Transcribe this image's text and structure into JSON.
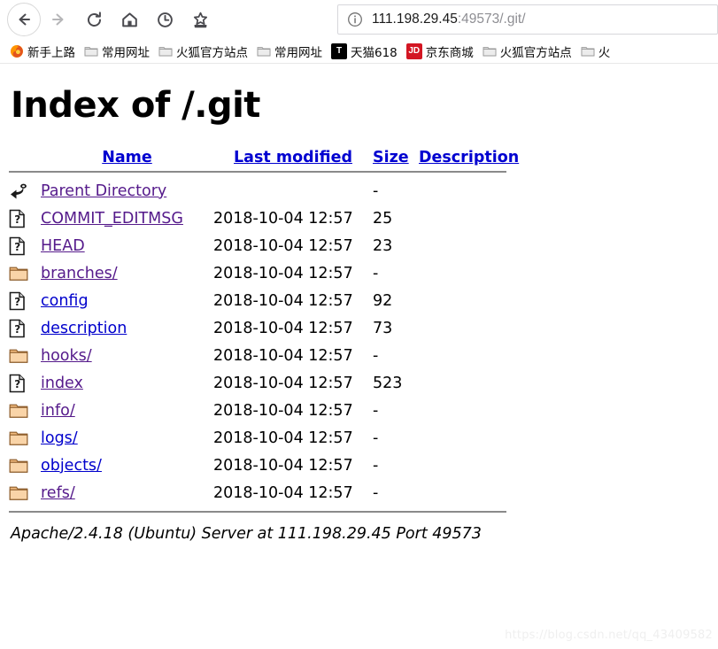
{
  "browser": {
    "nav_buttons": [
      {
        "name": "back",
        "label": "Back",
        "state": "enabled"
      },
      {
        "name": "forward",
        "label": "Forward",
        "state": "disabled"
      },
      {
        "name": "reload",
        "label": "Reload",
        "state": "enabled"
      },
      {
        "name": "home",
        "label": "Home",
        "state": "enabled"
      },
      {
        "name": "history",
        "label": "History",
        "state": "enabled"
      },
      {
        "name": "bookmark",
        "label": "Bookmark this page",
        "state": "enabled"
      }
    ],
    "url_bar": {
      "identity_icon": "info-icon",
      "host": "111.198.29.45",
      "port_path": ":49573/.git/",
      "full_url": "111.198.29.45:49573/.git/"
    },
    "bookmarks": [
      {
        "label": "新手上路",
        "icon": "firefox-icon",
        "icon_kind": "firefox"
      },
      {
        "label": "常用网址",
        "icon": "folder-icon",
        "icon_kind": "folder"
      },
      {
        "label": "火狐官方站点",
        "icon": "folder-icon",
        "icon_kind": "folder"
      },
      {
        "label": "常用网址",
        "icon": "folder-icon",
        "icon_kind": "folder"
      },
      {
        "label": "天猫618",
        "icon": "tmall-icon",
        "icon_kind": "tag",
        "tag_text": "T",
        "tag_color": "#000000"
      },
      {
        "label": "京东商城",
        "icon": "jd-icon",
        "icon_kind": "tag",
        "tag_text": "JD",
        "tag_color": "#d31623"
      },
      {
        "label": "火狐官方站点",
        "icon": "folder-icon",
        "icon_kind": "folder"
      },
      {
        "label": "火",
        "icon": "folder-icon",
        "icon_kind": "folder"
      }
    ]
  },
  "page": {
    "title": "Index of /.git",
    "headers": {
      "name": "Name",
      "last_modified": "Last modified",
      "size": "Size",
      "description": "Description"
    },
    "rows": [
      {
        "icon": "parent-directory-icon",
        "name": "Parent Directory",
        "date": "",
        "size": "-",
        "description": "",
        "visited": true
      },
      {
        "icon": "unknown-file-icon",
        "name": "COMMIT_EDITMSG",
        "date": "2018-10-04 12:57",
        "size": "25",
        "description": "",
        "visited": true
      },
      {
        "icon": "unknown-file-icon",
        "name": "HEAD",
        "date": "2018-10-04 12:57",
        "size": "23",
        "description": "",
        "visited": true
      },
      {
        "icon": "folder-icon",
        "name": "branches/",
        "date": "2018-10-04 12:57",
        "size": "-",
        "description": "",
        "visited": true
      },
      {
        "icon": "unknown-file-icon",
        "name": "config",
        "date": "2018-10-04 12:57",
        "size": "92",
        "description": "",
        "visited": false
      },
      {
        "icon": "unknown-file-icon",
        "name": "description",
        "date": "2018-10-04 12:57",
        "size": "73",
        "description": "",
        "visited": false
      },
      {
        "icon": "folder-icon",
        "name": "hooks/",
        "date": "2018-10-04 12:57",
        "size": "-",
        "description": "",
        "visited": true
      },
      {
        "icon": "unknown-file-icon",
        "name": "index",
        "date": "2018-10-04 12:57",
        "size": "523",
        "description": "",
        "visited": true
      },
      {
        "icon": "folder-icon",
        "name": "info/",
        "date": "2018-10-04 12:57",
        "size": "-",
        "description": "",
        "visited": true
      },
      {
        "icon": "folder-icon",
        "name": "logs/",
        "date": "2018-10-04 12:57",
        "size": "-",
        "description": "",
        "visited": false
      },
      {
        "icon": "folder-icon",
        "name": "objects/",
        "date": "2018-10-04 12:57",
        "size": "-",
        "description": "",
        "visited": false
      },
      {
        "icon": "folder-icon",
        "name": "refs/",
        "date": "2018-10-04 12:57",
        "size": "-",
        "description": "",
        "visited": true
      }
    ],
    "footer": "Apache/2.4.18 (Ubuntu) Server at 111.198.29.45 Port 49573"
  },
  "watermark": "https://blog.csdn.net/qq_43409582",
  "colors": {
    "link": "#0000cc",
    "link_visited": "#551a8b",
    "header_link": "#0000d0",
    "rule": "#8a8a8a",
    "folder": "#f5c98a",
    "text": "#000000"
  }
}
